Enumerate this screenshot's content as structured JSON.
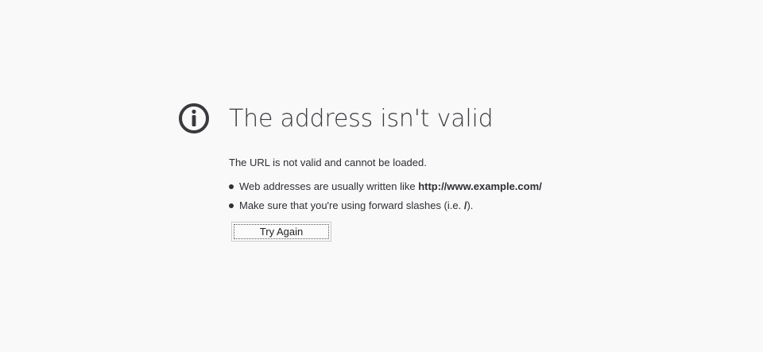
{
  "error": {
    "title": "The address isn't valid",
    "description": "The URL is not valid and cannot be loaded.",
    "hints": [
      {
        "text": "Web addresses are usually written like ",
        "bold": "http://www.example.com/",
        "suffix": ""
      },
      {
        "text": "Make sure that you're using forward slashes (i.e. ",
        "bold": "/",
        "suffix": ")."
      }
    ],
    "try_again_label": "Try Again"
  },
  "icon": "info-circle-icon",
  "colors": {
    "background": "#f9f9fa",
    "icon": "#3a3a3e",
    "text": "#2f2f34"
  }
}
